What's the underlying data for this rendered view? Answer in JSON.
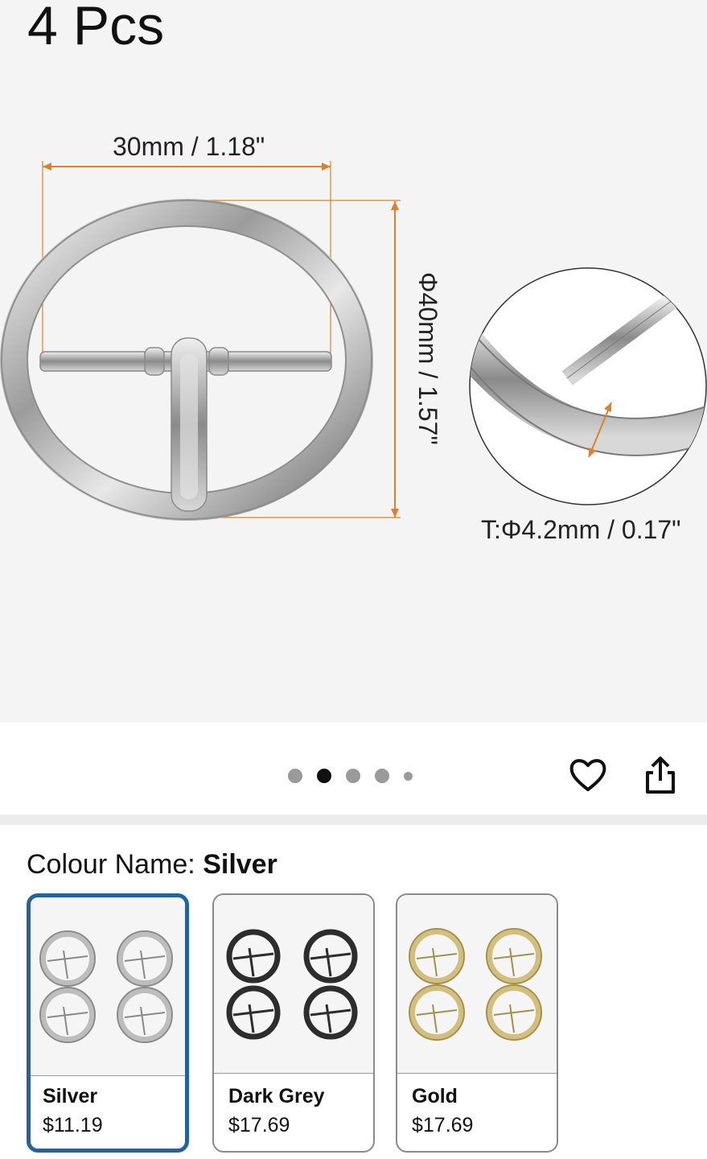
{
  "hero": {
    "title": "4 Pcs",
    "width_dim": "30mm / 1.18\"",
    "height_dim": "Φ40mm / 1.57\"",
    "thickness_dim": "T:Φ4.2mm / 0.17\"",
    "dim_color": "#d9822b"
  },
  "carousel": {
    "count": 5,
    "active_index": 1
  },
  "actions": {
    "wishlist_icon": "heart-icon",
    "share_icon": "share-icon"
  },
  "variation": {
    "label": "Colour Name: ",
    "selected": "Silver",
    "options": [
      {
        "name": "Silver",
        "price": "$11.19",
        "color": "#c9c9c9"
      },
      {
        "name": "Dark Grey",
        "price": "$17.69",
        "color": "#2d2d2d"
      },
      {
        "name": "Gold",
        "price": "$17.69",
        "color": "#d2bf7e"
      }
    ],
    "selected_border_color": "#2162a1"
  }
}
